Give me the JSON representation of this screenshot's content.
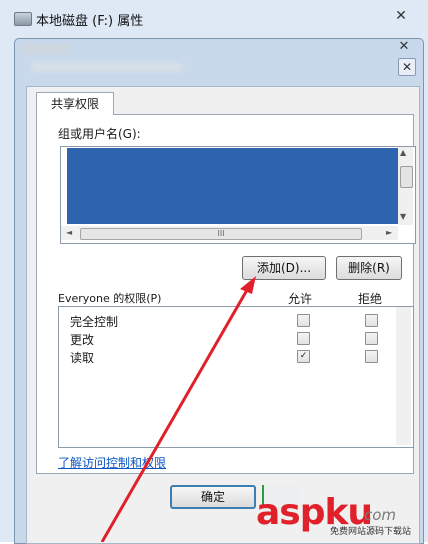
{
  "back_window": {
    "title": "本地磁盘 (F:) 属性",
    "close": "✕"
  },
  "dialog": {
    "close": "✕",
    "close2": "✕"
  },
  "tab": {
    "label": "共享权限"
  },
  "group_users": {
    "label": "组或用户名(G):",
    "hscroll_grip": "III",
    "scroll_up": "▲",
    "scroll_down": "▼",
    "scroll_left": "◄",
    "scroll_right": "►"
  },
  "buttons": {
    "add": "添加(D)...",
    "remove": "删除(R)",
    "ok": "确定"
  },
  "permissions": {
    "label": "Everyone 的权限(P)",
    "allow_header": "允许",
    "deny_header": "拒绝",
    "rows": [
      {
        "name": "完全控制",
        "allow": false,
        "deny": false
      },
      {
        "name": "更改",
        "allow": false,
        "deny": false
      },
      {
        "name": "读取",
        "allow": true,
        "deny": false
      }
    ]
  },
  "link": {
    "text": "了解访问控制和权限"
  },
  "watermark": {
    "brand": "aspku",
    "dot": ".",
    "tld": "com",
    "sub": "免费网站源码下载站"
  },
  "colors": {
    "selection": "#2e63ad",
    "arrow": "#e0202a",
    "link": "#0b56c7"
  }
}
